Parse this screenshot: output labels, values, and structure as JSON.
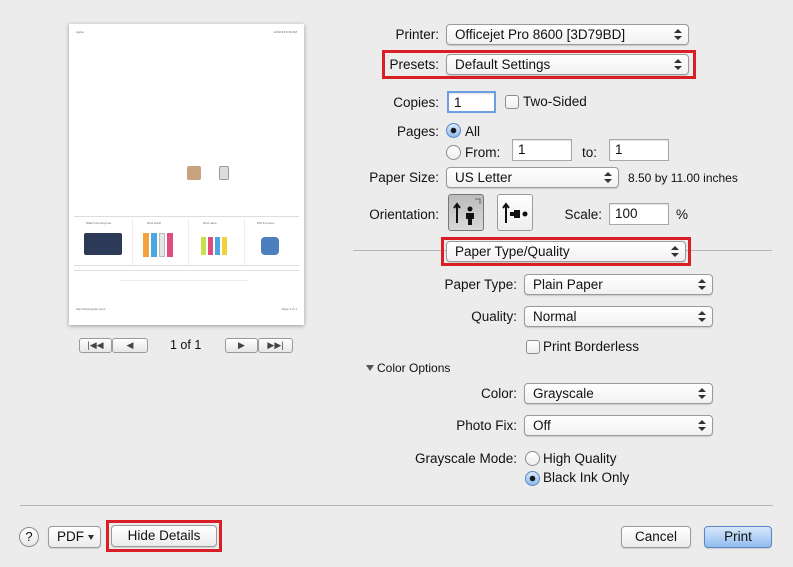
{
  "preview": {
    "header_left": "Apple",
    "header_right": "12/20/13 9:36 AM",
    "footer_left": "http://www.apple.com/",
    "footer_right": "Page 1 of 1",
    "thumbs": [
      {
        "label": "Watch the Keynote"
      },
      {
        "label": "iPod touch"
      },
      {
        "label": "iPod nano"
      },
      {
        "label": "iOS 6 is here"
      }
    ],
    "page_indicator": "1 of 1",
    "nav": {
      "first": "|◀◀",
      "prev": "◀",
      "next": "▶",
      "last": "▶▶|"
    }
  },
  "printer": {
    "label": "Printer:",
    "value": "Officejet Pro 8600 [3D79BD]"
  },
  "presets": {
    "label": "Presets:",
    "value": "Default Settings"
  },
  "copies": {
    "label": "Copies:",
    "value": "1",
    "two_sided_label": "Two-Sided",
    "two_sided_checked": false
  },
  "pages": {
    "label": "Pages:",
    "all_label": "All",
    "from_label": "From:",
    "from_value": "1",
    "to_label": "to:",
    "to_value": "1",
    "selected": "All"
  },
  "paper_size": {
    "label": "Paper Size:",
    "value": "US Letter",
    "dimensions": "8.50 by 11.00 inches"
  },
  "orientation": {
    "label": "Orientation:",
    "selected": "portrait",
    "icons": [
      "portrait-icon",
      "landscape-icon"
    ]
  },
  "scale": {
    "label": "Scale:",
    "value": "100",
    "unit": "%"
  },
  "section": {
    "value": "Paper Type/Quality"
  },
  "paper_type": {
    "label": "Paper Type:",
    "value": "Plain Paper"
  },
  "quality": {
    "label": "Quality:",
    "value": "Normal"
  },
  "borderless": {
    "label": "Print Borderless",
    "checked": false
  },
  "color_options": {
    "label": "Color Options",
    "expanded": true
  },
  "color": {
    "label": "Color:",
    "value": "Grayscale"
  },
  "photo_fix": {
    "label": "Photo Fix:",
    "value": "Off"
  },
  "grayscale_mode": {
    "label": "Grayscale Mode:",
    "options": [
      "High Quality",
      "Black Ink Only"
    ],
    "selected": "Black Ink Only"
  },
  "footer": {
    "help": "?",
    "pdf": "PDF",
    "hide_details": "Hide Details",
    "cancel": "Cancel",
    "print": "Print"
  },
  "highlight_color": "#d91f26",
  "accent_color": "#93bdf0"
}
